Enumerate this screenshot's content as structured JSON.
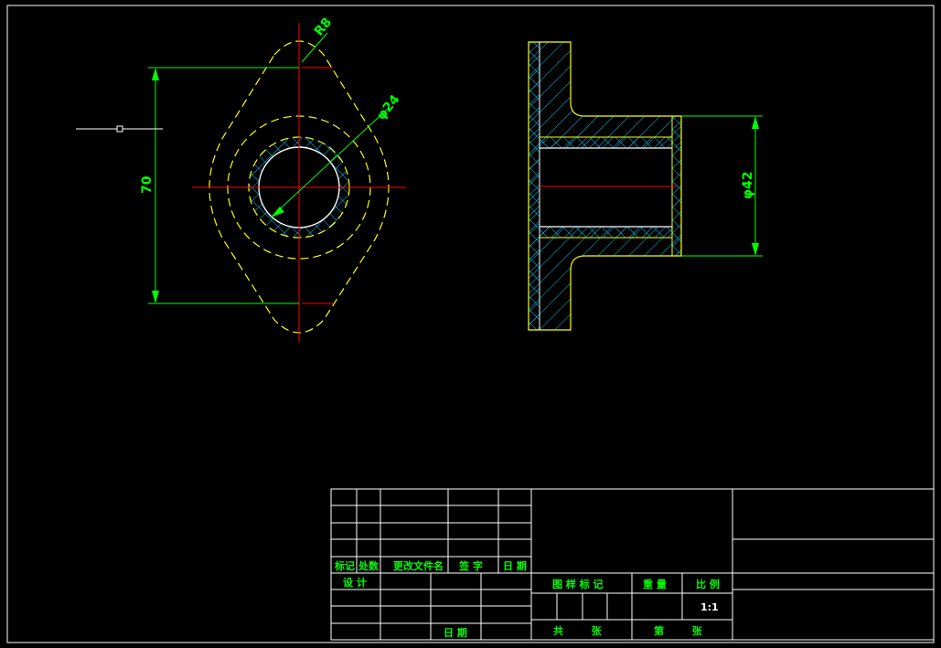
{
  "colors": {
    "background": "#000000",
    "outline": "#ffffff",
    "part_edge": "#ffff00",
    "center_line": "#ff0000",
    "dimension": "#00ff00",
    "hatch": "#00c8ff"
  },
  "front_view": {
    "dims": {
      "height": "70",
      "radius": "R8",
      "diameter": "φ24"
    }
  },
  "section_view": {
    "dims": {
      "diameter": "φ42"
    }
  },
  "title_block": {
    "rev_headers": {
      "mark": "标记",
      "zone": "处数",
      "doc_no": "更改文件名",
      "signature": "签 字",
      "date": "日 期"
    },
    "design": "设 计",
    "date_label": "日 期",
    "drawing_mark": "图 样 标 记",
    "weight": "重 量",
    "scale_label": "比 例",
    "scale_value": "1:1",
    "sheets_total": "共        张",
    "sheet_no": "第        张"
  }
}
